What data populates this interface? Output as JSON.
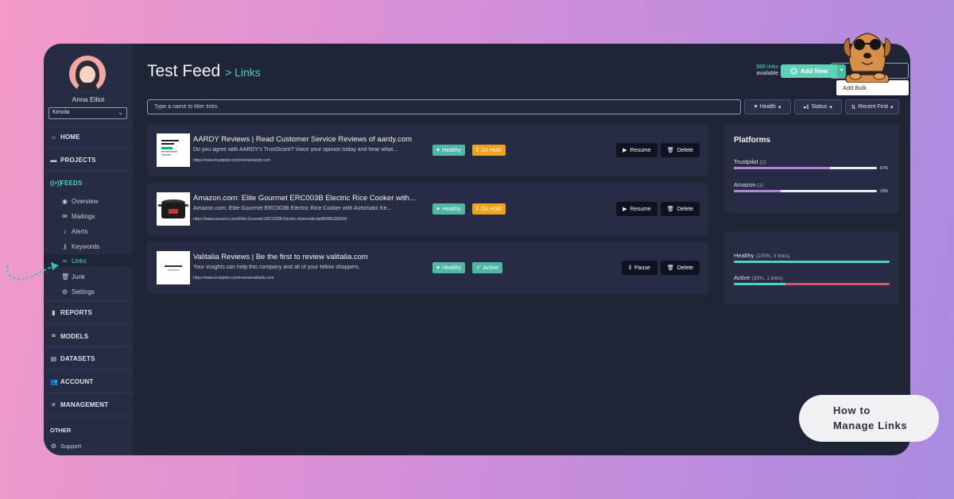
{
  "user": {
    "name": "Anna Elliot",
    "org": "Kimola"
  },
  "nav": {
    "home": "HOME",
    "projects": "PROJECTS",
    "feeds": "FEEDS",
    "feed_items": [
      "Overview",
      "Mailings",
      "Alerts",
      "Keywords",
      "Links",
      "Junk",
      "Settings"
    ],
    "reports": "REPORTS",
    "models": "MODELS",
    "datasets": "DATASETS",
    "account": "ACCOUNT",
    "management": "MANAGEMENT",
    "other": "OTHER",
    "support": "Support"
  },
  "header": {
    "title": "Test Feed",
    "crumb": "> Links",
    "links_count": "988 links",
    "links_available": "available",
    "add_new": "Add New",
    "add_bulk": "Add Bulk"
  },
  "filter": {
    "placeholder": "Type a name to filter links.",
    "health": "Health",
    "status": "Status",
    "sort": "Recent First"
  },
  "links": [
    {
      "title": "AARDY Reviews | Read Customer Service Reviews of aardy.com",
      "desc": "Do you agree with AARDY's TrustScore? Voice your opinion today and hear what...",
      "url": "https://www.trustpilot.com/review/aardy.com",
      "health": "Healthy",
      "status": "On Hold",
      "action": "Resume",
      "delete": "Delete"
    },
    {
      "title": "Amazon.com: Elite Gourmet ERC003B Electric Rice Cooker with...",
      "desc": "Amazon.com: Elite Gourmet ERC003B Electric Rice Cooker with Automatic Ke...",
      "url": "https://www.amazon.com/Elite-Gourmet-ERC003B-Electric-Automatic/dp/B00BG8S8XK",
      "health": "Healthy",
      "status": "On Hold",
      "action": "Resume",
      "delete": "Delete"
    },
    {
      "title": "Valitalia Reviews | Be the first to review valitalia.com",
      "desc": "Your insights can help this company and all of your fellow shoppers.",
      "url": "https://www.trustpilot.com/review/valitalia.com",
      "health": "Healthy",
      "status": "Active",
      "action": "Pause",
      "delete": "Delete"
    }
  ],
  "platforms": {
    "title": "Platforms",
    "items": [
      {
        "name": "Trustpilot",
        "count": "(2)",
        "pct_label": "67%",
        "fraction": 0.67
      },
      {
        "name": "Amazon",
        "count": "(1)",
        "pct_label": "33%",
        "fraction": 0.33
      }
    ]
  },
  "status_panel": {
    "healthy_label": "Healthy",
    "healthy_detail": "(100%, 3 links)",
    "healthy_fraction": 1.0,
    "active_label": "Active",
    "active_detail": "(33%, 1 links)",
    "active_fraction": 0.33
  },
  "howto": {
    "line1": "How to",
    "line2": "Manage Links"
  },
  "colors": {
    "accent": "#4fd1c5",
    "hold": "#f3a21b",
    "platform_bar": "#b682e0",
    "inactive": "#d9566a"
  }
}
